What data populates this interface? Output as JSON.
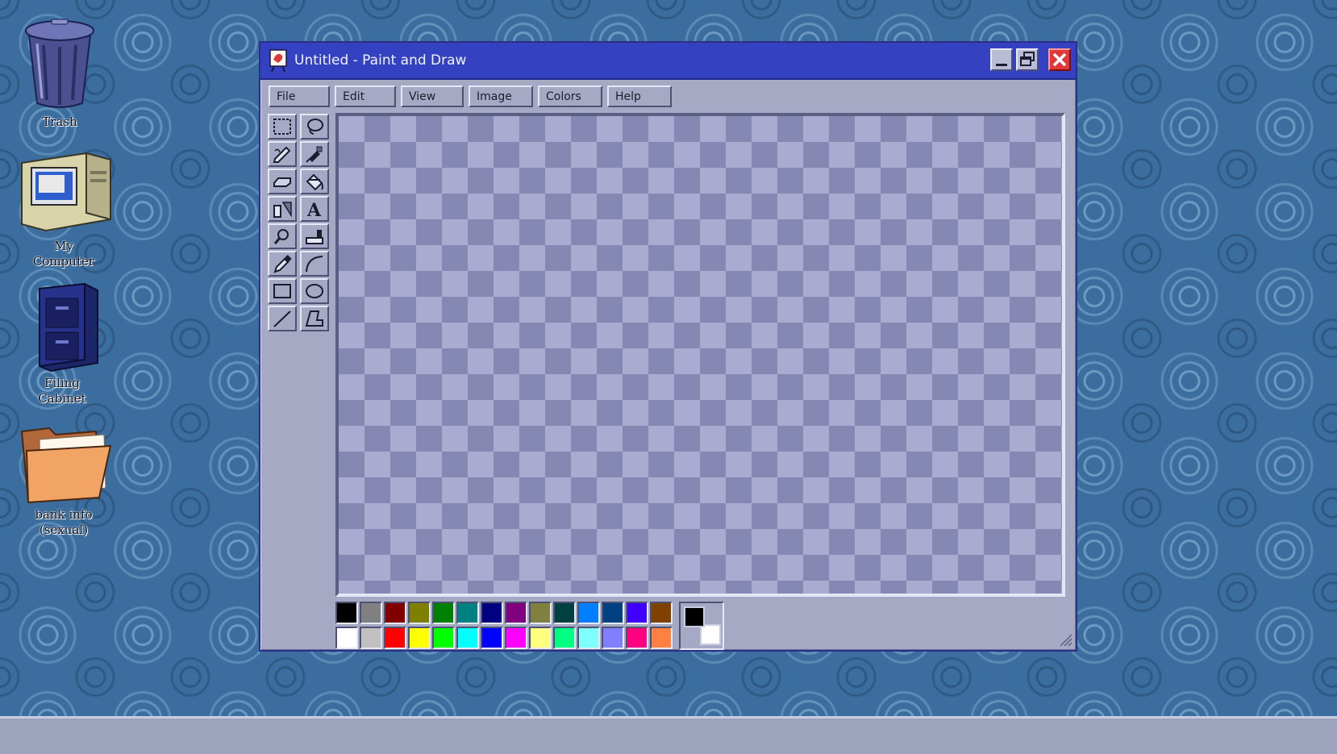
{
  "desktop": {
    "icons": [
      {
        "label": "Trash",
        "icon": "trash-icon"
      },
      {
        "label": "My Computer",
        "icon": "computer-icon"
      },
      {
        "label": "Filing Cabinet",
        "icon": "filing-cabinet-icon"
      },
      {
        "label": "bank info (sexual)",
        "icon": "folder-icon"
      }
    ]
  },
  "window": {
    "title": "Untitled - Paint and Draw",
    "app_icon": "paint-app-icon",
    "controls": [
      "minimize",
      "restore",
      "close"
    ]
  },
  "menu": {
    "items": [
      "File",
      "Edit",
      "View",
      "Image",
      "Colors",
      "Help"
    ]
  },
  "tools": [
    "rect-select",
    "free-select",
    "pencil",
    "airbrush",
    "eraser",
    "fill-bucket",
    "stamp",
    "text",
    "zoom",
    "brush",
    "color-picker",
    "curve",
    "rectangle",
    "ellipse",
    "line",
    "polygon"
  ],
  "palette": {
    "row1": [
      "#000000",
      "#808080",
      "#800000",
      "#808000",
      "#008000",
      "#008080",
      "#000080",
      "#800080",
      "#808040",
      "#004040",
      "#0080ff",
      "#004080",
      "#4000ff",
      "#804000"
    ],
    "row2": [
      "#ffffff",
      "#c0c0c0",
      "#ff0000",
      "#ffff00",
      "#00ff00",
      "#00ffff",
      "#0000ff",
      "#ff00ff",
      "#ffff80",
      "#00ff80",
      "#80ffff",
      "#8080ff",
      "#ff0080",
      "#ff8040"
    ],
    "foreground": "#000000",
    "background": "#ffffff"
  },
  "colors": {
    "title_bar": "#3442c2",
    "window_face": "#a5a9c4",
    "desktop": "#3b6e9e"
  }
}
